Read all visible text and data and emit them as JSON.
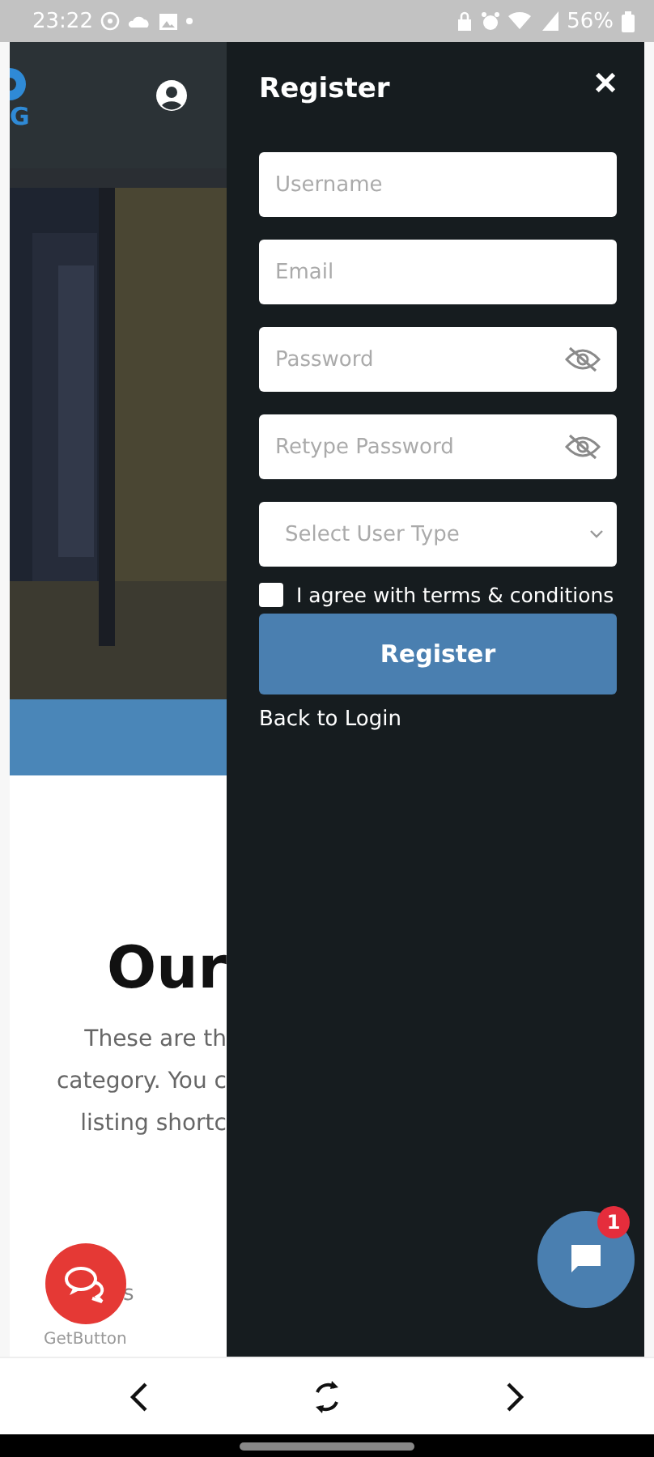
{
  "status_bar": {
    "time": "23:22",
    "battery": "56%"
  },
  "page": {
    "logo_text": "G",
    "heading": "Our",
    "description": [
      "These are th",
      "category. You c",
      "listing shortc"
    ],
    "partial_text": "s"
  },
  "register_panel": {
    "title": "Register",
    "close": "×",
    "fields": [
      {
        "kind": "text",
        "placeholder": "Username"
      },
      {
        "kind": "text",
        "placeholder": "Email"
      },
      {
        "kind": "password",
        "placeholder": "Password"
      },
      {
        "kind": "password",
        "placeholder": "Retype Password"
      },
      {
        "kind": "select",
        "placeholder": "Select User Type"
      }
    ],
    "terms": {
      "label": "I agree with terms & conditions",
      "checked": false
    },
    "submit": "Register",
    "back_link": "Back to Login"
  },
  "chat_widget": {
    "badge": "1"
  },
  "get_button": {
    "label": "GetButton"
  }
}
